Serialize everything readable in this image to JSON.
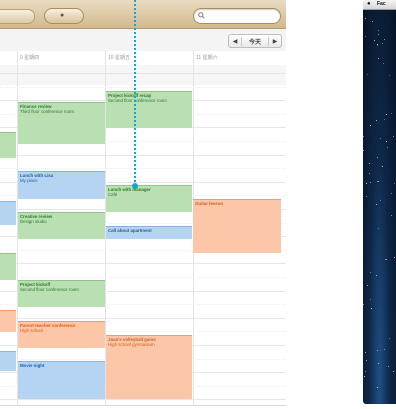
{
  "toolbar": {
    "search_placeholder": "Q"
  },
  "navbar": {
    "prev": "◀",
    "today": "今天",
    "next": "▶"
  },
  "day_headers": [
    "9 星期四",
    "10 星期五",
    "11 星期六"
  ],
  "events": [
    {
      "title": "Project kickoff recap",
      "subtitle": "Second floor conference room",
      "color": "green"
    },
    {
      "title": "Finance review",
      "subtitle": "Third floor conference room",
      "color": "green"
    },
    {
      "title": "Lunch with Lisa",
      "subtitle": "My place",
      "color": "blue"
    },
    {
      "title": "Lunch with manager",
      "subtitle": "Café",
      "color": "green"
    },
    {
      "title": "Guitar lesson",
      "subtitle": "",
      "color": "orange"
    },
    {
      "title": "Creative review",
      "subtitle": "Design studio",
      "color": "green"
    },
    {
      "title": "Call about apartment",
      "subtitle": "",
      "color": "blue"
    },
    {
      "title": "Project kickoff",
      "subtitle": "Second floor conference room",
      "color": "green"
    },
    {
      "title": "Parent-teacher conference",
      "subtitle": "High school",
      "color": "orange"
    },
    {
      "title": "Joan's volleyball game",
      "subtitle": "High school gymnasium",
      "color": "orange"
    },
    {
      "title": "Movie night",
      "subtitle": "",
      "color": "blue"
    }
  ],
  "desktop": {
    "apple_icon": "apple-logo",
    "menu_app": "Fac"
  },
  "colors": {
    "toolbar": "#d2b98e",
    "green_event": "#b9dfb3",
    "blue_event": "#b5d4f2",
    "orange_event": "#fcc7a8",
    "drag_indicator": "#1aa7c7"
  }
}
